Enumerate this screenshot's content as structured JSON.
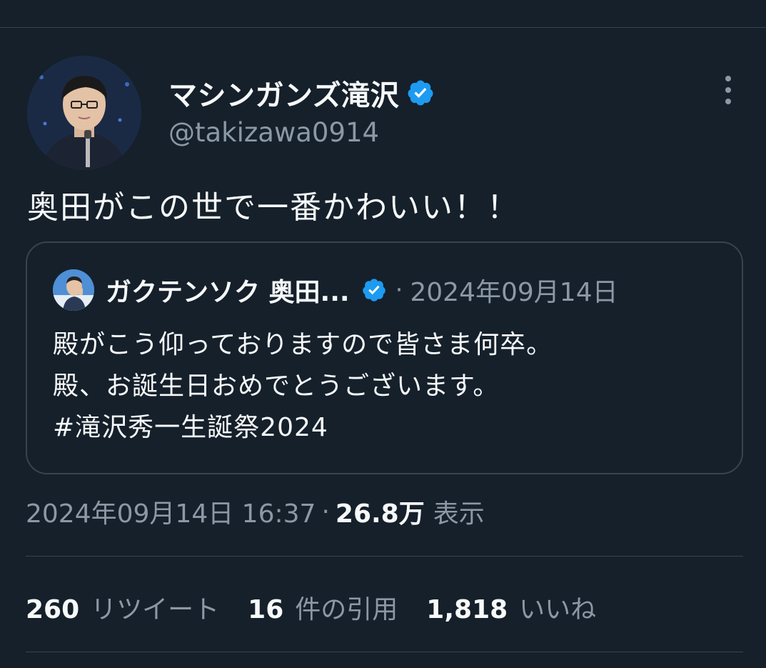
{
  "tweet": {
    "author": {
      "name": "マシンガンズ滝沢",
      "handle": "@takizawa0914",
      "verified": true
    },
    "text": "奥田がこの世で一番かわいい！！",
    "quoted": {
      "author_name": "ガクテンソク 奥田...",
      "verified": true,
      "separator": "·",
      "date": "2024年09月14日",
      "lines": [
        "殿がこう仰っておりますので皆さま何卒。",
        "殿、お誕生日おめでとうございます。",
        "#滝沢秀一生誕祭2024"
      ]
    },
    "meta": {
      "timestamp": "2024年09月14日 16:37",
      "separator": "·",
      "views_count": "26.8万",
      "views_label": "表示"
    },
    "stats": {
      "retweets_count": "260",
      "retweets_label": "リツイート",
      "quotes_count": "16",
      "quotes_label": "件の引用",
      "likes_count": "1,818",
      "likes_label": "いいね"
    }
  },
  "icons": {
    "verified": "verified-badge-icon",
    "more": "more-vertical-icon"
  },
  "colors": {
    "background": "#15202b",
    "text_primary": "#f7f9f9",
    "text_secondary": "#8b98a5",
    "border": "#38444d",
    "verified_blue": "#1d9bf0"
  }
}
